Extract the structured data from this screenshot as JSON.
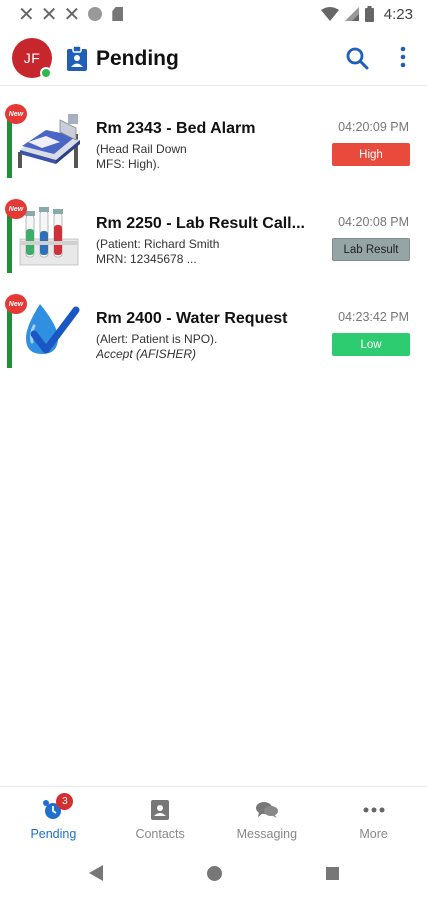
{
  "status_bar": {
    "time": "4:23",
    "icons": [
      "x-notification-icon",
      "x-notification-icon",
      "x-notification-icon",
      "circle-notification-icon",
      "sim-card-icon",
      "wifi-icon",
      "signal-icon",
      "battery-icon"
    ]
  },
  "header": {
    "avatar_initials": "JF",
    "title": "Pending",
    "accent_color": "#1f6fd1"
  },
  "alerts": [
    {
      "new_label": "New",
      "title": "Rm 2343 - Bed Alarm",
      "line1": "(Head Rail Down",
      "line2": "MFS: High).",
      "line2_italic": false,
      "time": "04:20:09 PM",
      "priority": "High",
      "priority_color": "#e84b3c",
      "thumbnail": "hospital-bed-icon"
    },
    {
      "new_label": "New",
      "title": "Rm 2250 - Lab Result Call...",
      "line1": "(Patient: Richard Smith",
      "line2": "MRN: 12345678 ...",
      "line2_italic": false,
      "time": "04:20:08 PM",
      "priority": "Lab Result",
      "priority_color": "#95a5a6",
      "thumbnail": "test-tubes-icon"
    },
    {
      "new_label": "New",
      "title": "Rm 2400 - Water Request",
      "line1": "(Alert: Patient is NPO).",
      "line2": "Accept (AFISHER)",
      "line2_italic": true,
      "time": "04:23:42 PM",
      "priority": "Low",
      "priority_color": "#2ecc71",
      "thumbnail": "water-drop-check-icon"
    }
  ],
  "bottom_nav": {
    "items": [
      {
        "label": "Pending",
        "icon": "alarm-clock-icon",
        "badge": "3",
        "active": true
      },
      {
        "label": "Contacts",
        "icon": "contact-card-icon",
        "active": false
      },
      {
        "label": "Messaging",
        "icon": "chat-bubbles-icon",
        "active": false
      },
      {
        "label": "More",
        "icon": "more-horiz-icon",
        "active": false
      }
    ]
  },
  "colors": {
    "new_badge": "#e53935",
    "item_bar": "#1f8f3a",
    "avatar": "#c6262c",
    "presence": "#2eb84a"
  }
}
